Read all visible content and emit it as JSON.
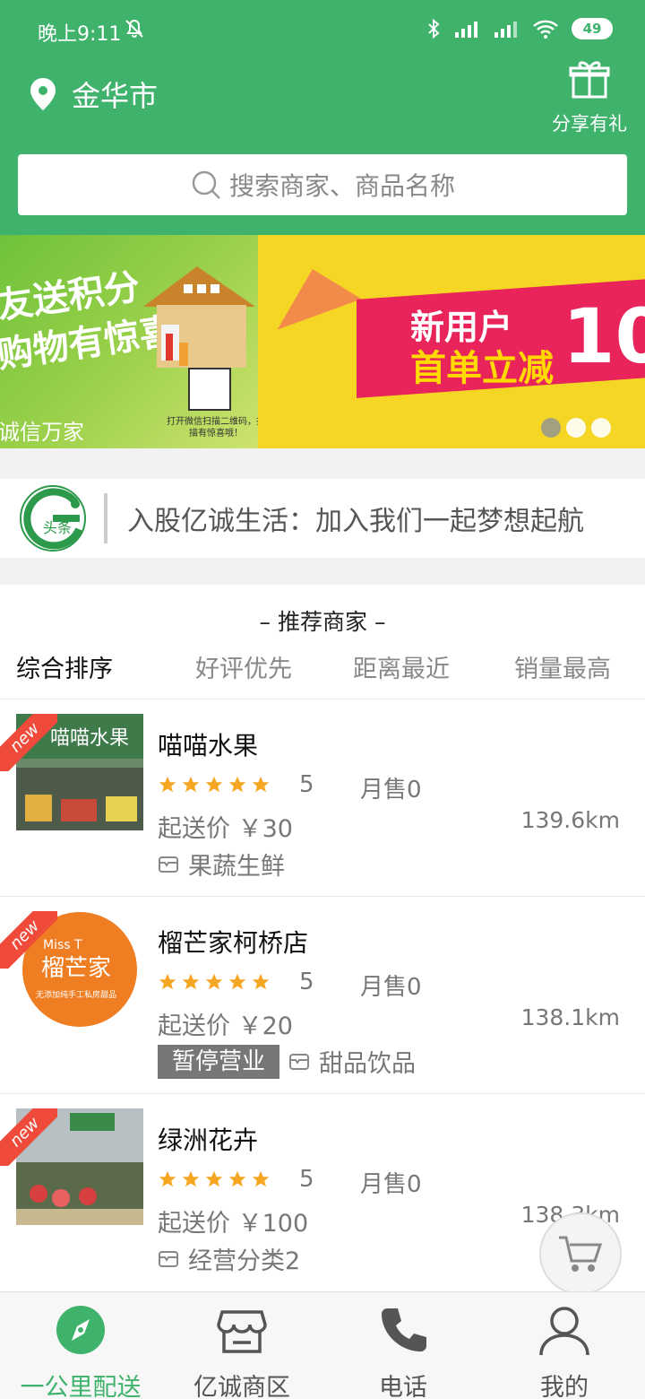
{
  "status_bar": {
    "time": "晚上9:11",
    "battery": "49"
  },
  "header": {
    "city": "金华市",
    "share_label": "分享有礼",
    "search_placeholder": "搜索商家、商品名称"
  },
  "banner": {
    "slide1": {
      "line1": "友送积分",
      "line2": "购物有惊喜",
      "brand": "诚信万家",
      "qr_caption": "打开微信扫描二维码，扫描有惊喜哦！"
    },
    "slide2": {
      "line1": "新用户",
      "line2": "首单立减",
      "amount": "10"
    },
    "active_dot": 0
  },
  "news": {
    "logo_text": "头条",
    "headline": "入股亿诚生活：加入我们一起梦想起航"
  },
  "recommend": {
    "title": "– 推荐商家 –",
    "sorts": [
      "综合排序",
      "好评优先",
      "距离最近",
      "销量最高"
    ],
    "merchants": [
      {
        "name": "喵喵水果",
        "score": "5",
        "sales": "月售0",
        "min_price": "起送价 ￥30",
        "distance": "139.6km",
        "category": "果蔬生鲜",
        "status": "",
        "badge": "new",
        "thumb_text": "喵喵水果"
      },
      {
        "name": "榴芒家柯桥店",
        "score": "5",
        "sales": "月售0",
        "min_price": "起送价 ￥20",
        "distance": "138.1km",
        "category": "甜品饮品",
        "status": "暂停营业",
        "badge": "new",
        "thumb_text": "榴芒家",
        "thumb_sub": "Miss T",
        "thumb_small": "无添加纯手工私房甜品"
      },
      {
        "name": "绿洲花卉",
        "score": "5",
        "sales": "月售0",
        "min_price": "起送价 ￥100",
        "distance": "138.3km",
        "category": "经营分类2",
        "status": "",
        "badge": "new",
        "thumb_text": ""
      }
    ]
  },
  "tabs": [
    "一公里配送",
    "亿诚商区",
    "电话",
    "我的"
  ],
  "colors": {
    "brand_green": "#3fb36c",
    "star": "#f5a623",
    "badge_red": "#f04a3a"
  },
  "icons": [
    "location-pin-icon",
    "gift-icon",
    "search-icon",
    "cart-icon",
    "compass-icon",
    "store-icon",
    "phone-icon",
    "user-icon"
  ]
}
